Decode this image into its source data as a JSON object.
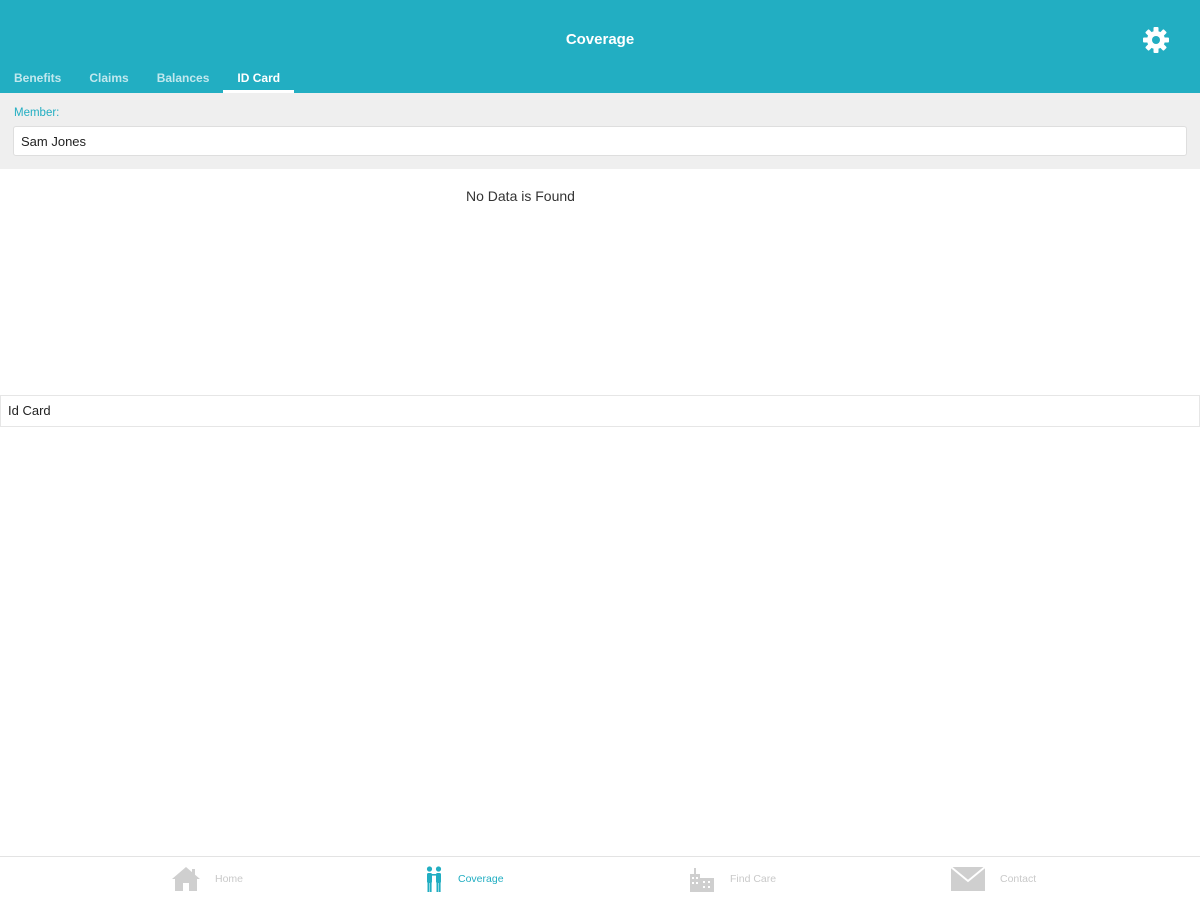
{
  "header": {
    "title": "Coverage",
    "settings_icon": "gear-icon",
    "background_color": "#22aec2"
  },
  "tabs": [
    {
      "label": "Benefits",
      "active": false
    },
    {
      "label": "Claims",
      "active": false
    },
    {
      "label": "Balances",
      "active": false
    },
    {
      "label": "ID Card",
      "active": true
    }
  ],
  "member": {
    "label": "Member:",
    "value": "Sam Jones"
  },
  "content": {
    "empty_message": "No Data is Found",
    "id_card_row_label": "Id Card"
  },
  "bottom_nav": [
    {
      "label": "Home",
      "icon": "home-icon",
      "active": false
    },
    {
      "label": "Coverage",
      "icon": "people-icon",
      "active": true
    },
    {
      "label": "Find Care",
      "icon": "buildings-icon",
      "active": false
    },
    {
      "label": "Contact",
      "icon": "envelope-icon",
      "active": false
    }
  ],
  "colors": {
    "accent": "#22aec2",
    "panel_background": "#efefef",
    "inactive_nav": "#c9c9c9"
  }
}
